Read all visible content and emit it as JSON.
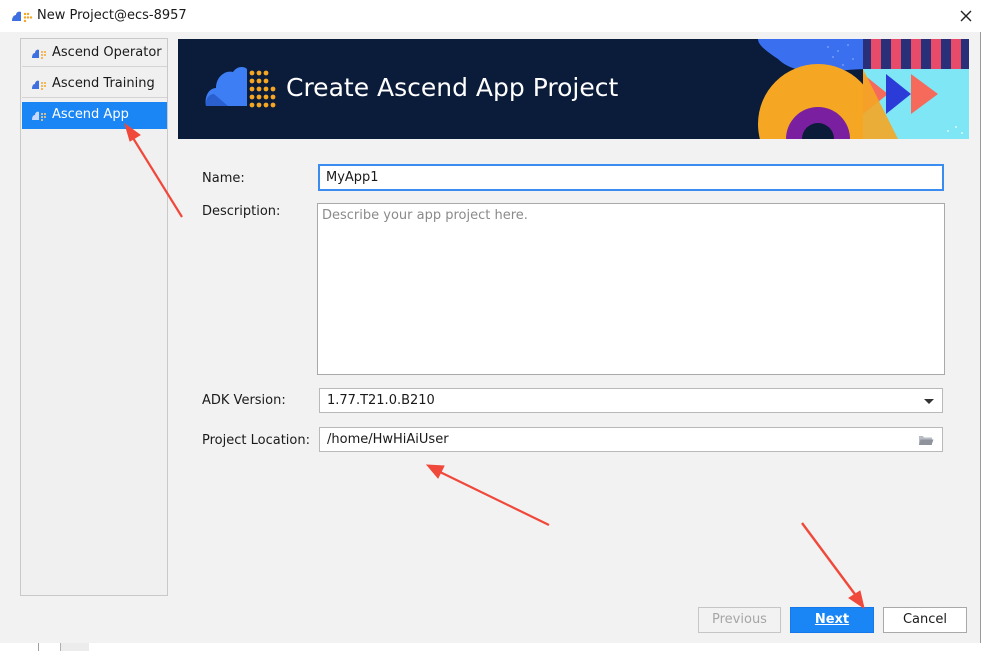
{
  "window": {
    "title": "New Project@ecs-8957",
    "app_icon": "ascend-cloud-icon",
    "close_icon": "close-icon"
  },
  "sidebar": {
    "items": [
      {
        "label": "Ascend Operator",
        "icon": "ascend-icon",
        "selected": false
      },
      {
        "label": "Ascend Training",
        "icon": "ascend-icon",
        "selected": false
      },
      {
        "label": "Ascend App",
        "icon": "ascend-icon",
        "selected": true
      }
    ]
  },
  "banner": {
    "title": "Create Ascend App Project",
    "logo": "ascend-cloud-logo"
  },
  "form": {
    "name_label": "Name:",
    "name_value": "MyApp1",
    "description_label": "Description:",
    "description_placeholder": "Describe your app project here.",
    "adk_label": "ADK Version:",
    "adk_value": "1.77.T21.0.B210",
    "location_label": "Project Location:",
    "location_value": "/home/HwHiAiUser",
    "folder_icon": "folder-open-icon"
  },
  "buttons": {
    "previous": "Previous",
    "next": "Next",
    "cancel": "Cancel"
  },
  "colors": {
    "accent": "#1a86f5",
    "banner_bg": "#0b1b3a",
    "annotation_arrow": "#f0483a"
  }
}
